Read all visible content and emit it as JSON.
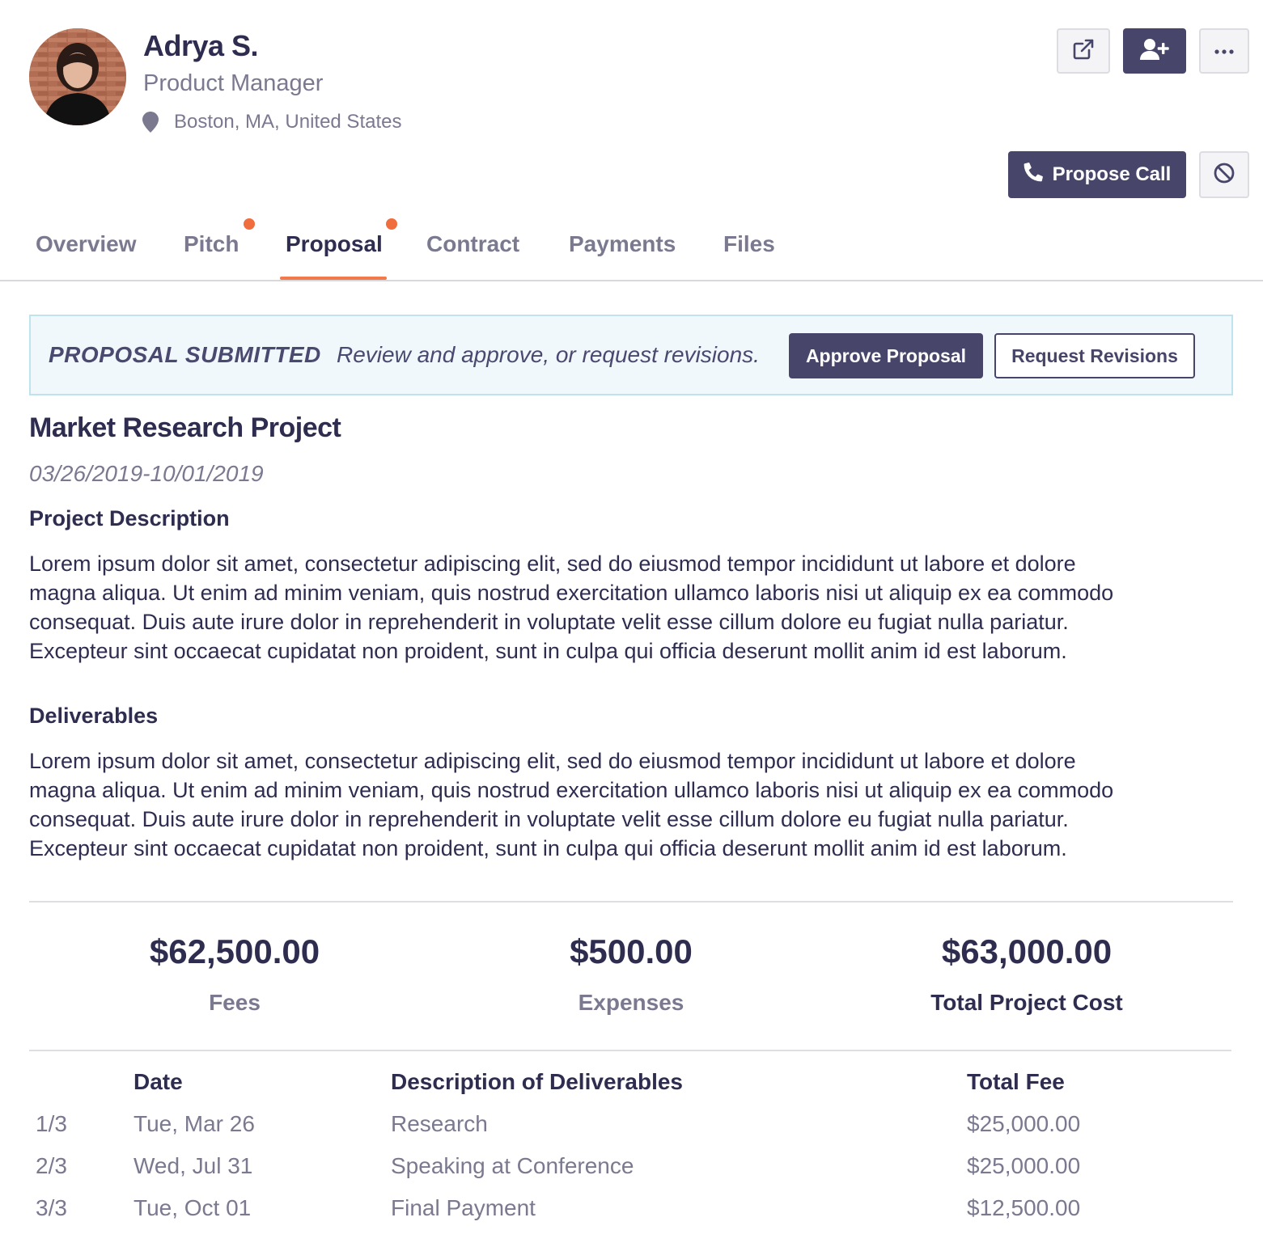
{
  "profile": {
    "name": "Adrya S.",
    "role": "Product Manager",
    "location": "Boston, MA, United States"
  },
  "header_actions": {
    "external_link_icon": "external-link-icon",
    "add_user_icon": "add-user-icon",
    "more_icon": "more-icon",
    "propose_call_label": "Propose Call",
    "block_icon": "block-icon"
  },
  "tabs": [
    {
      "label": "Overview",
      "active": false,
      "notification": false
    },
    {
      "label": "Pitch",
      "active": false,
      "notification": true
    },
    {
      "label": "Proposal",
      "active": true,
      "notification": true
    },
    {
      "label": "Contract",
      "active": false,
      "notification": false
    },
    {
      "label": "Payments",
      "active": false,
      "notification": false
    },
    {
      "label": "Files",
      "active": false,
      "notification": false
    }
  ],
  "banner": {
    "title": "PROPOSAL SUBMITTED",
    "message": "Review and approve, or request revisions.",
    "approve_label": "Approve Proposal",
    "revisions_label": "Request Revisions"
  },
  "project": {
    "title": "Market Research Project",
    "dates": "03/26/2019-10/01/2019",
    "description_heading": "Project Description",
    "description_lines": [
      "Lorem ipsum dolor sit amet, consectetur adipiscing elit, sed do eiusmod tempor incididunt ut labore et dolore",
      "magna aliqua. Ut enim ad minim veniam, quis nostrud exercitation ullamco laboris nisi ut aliquip ex ea commodo",
      "consequat. Duis aute irure dolor in reprehenderit in voluptate velit esse cillum dolore eu fugiat nulla pariatur.",
      "Excepteur sint occaecat cupidatat non proident, sunt in culpa qui officia deserunt mollit anim id est laborum."
    ],
    "deliverables_heading": "Deliverables",
    "deliverables_lines": [
      "Lorem ipsum dolor sit amet, consectetur adipiscing elit, sed do eiusmod tempor incididunt ut labore et dolore",
      "magna aliqua. Ut enim ad minim veniam, quis nostrud exercitation ullamco laboris nisi ut aliquip ex ea commodo",
      "consequat. Duis aute irure dolor in reprehenderit in voluptate velit esse cillum dolore eu fugiat nulla pariatur.",
      "Excepteur sint occaecat cupidatat non proident, sunt in culpa qui officia deserunt mollit anim id est laborum."
    ]
  },
  "costs": {
    "fees_value": "$62,500.00",
    "fees_label": "Fees",
    "expenses_value": "$500.00",
    "expenses_label": "Expenses",
    "total_value": "$63,000.00",
    "total_label": "Total Project Cost"
  },
  "schedule": {
    "headers": {
      "date": "Date",
      "description": "Description of Deliverables",
      "fee": "Total Fee"
    },
    "rows": [
      {
        "index": "1/3",
        "date": "Tue, Mar 26",
        "description": "Research",
        "fee": "$25,000.00"
      },
      {
        "index": "2/3",
        "date": "Wed, Jul 31",
        "description": "Speaking at Conference",
        "fee": "$25,000.00"
      },
      {
        "index": "3/3",
        "date": "Tue, Oct 01",
        "description": "Final Payment",
        "fee": "$12,500.00"
      }
    ]
  },
  "colors": {
    "primary": "#47466a",
    "accent": "#f2794a",
    "banner_bg": "#f1f8fb",
    "banner_border": "#bfe3ec"
  }
}
